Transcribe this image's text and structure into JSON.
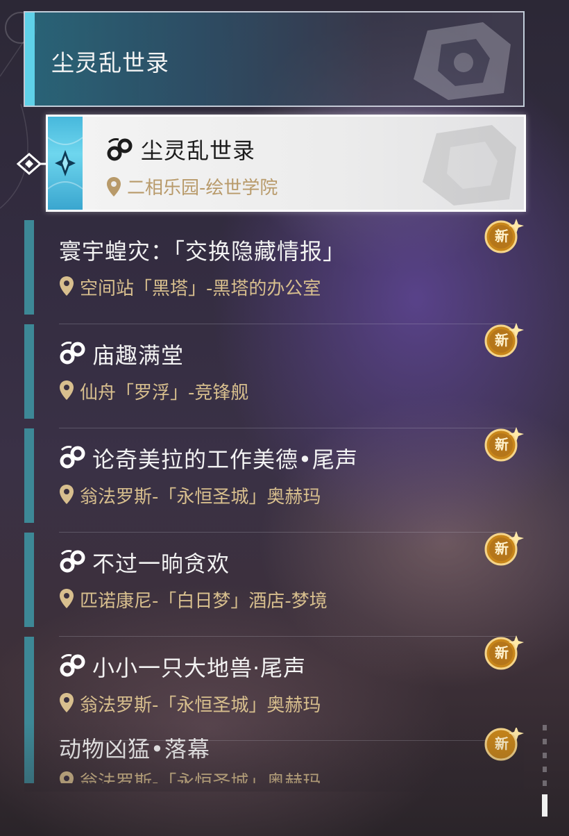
{
  "header": {
    "title": "尘灵乱世录"
  },
  "selected": {
    "title": "尘灵乱世录",
    "location": "二相乐园-绘世学院"
  },
  "missions": [
    {
      "title": "寰宇蝗灾：「交换隐藏情报」",
      "location": "空间站「黑塔」-黑塔的办公室",
      "badge": "新",
      "has_icon": false
    },
    {
      "title": "庙趣满堂",
      "location": "仙舟「罗浮」-竞锋舰",
      "badge": "新",
      "has_icon": true
    },
    {
      "title": "论奇美拉的工作美德•尾声",
      "location": "翁法罗斯-「永恒圣城」奥赫玛",
      "badge": "新",
      "has_icon": true
    },
    {
      "title": "不过一晌贪欢",
      "location": "匹诺康尼-「白日梦」酒店-梦境",
      "badge": "新",
      "has_icon": true
    },
    {
      "title": "小小一只大地兽·尾声",
      "location": "翁法罗斯-「永恒圣城」奥赫玛",
      "badge": "新",
      "has_icon": true
    }
  ],
  "partial_mission": {
    "title": "动物凶猛•落幕",
    "location": "翁法罗斯-「永恒圣城」奥赫玛",
    "badge": "新"
  },
  "colors": {
    "accent_cyan": "#5fd1e8",
    "bar_teal": "#3d8896",
    "location_gold": "#d8bf8e",
    "badge_gold": "#c8861a"
  },
  "icons": {
    "mission": "companion-mission-icon",
    "location": "location-pin-icon",
    "badge": "new-badge-icon",
    "selector": "selector-arrow-icon"
  }
}
